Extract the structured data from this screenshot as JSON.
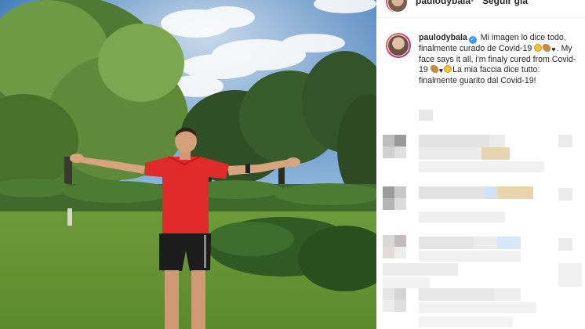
{
  "post": {
    "username": "paulodybala",
    "follow_label": "Seguir già",
    "header_dot": "•",
    "caption_emoji": [
      "grinning-face",
      "flexed-biceps",
      "heart",
      "flexed-biceps",
      "heart",
      "grinning-face"
    ]
  },
  "caption": {
    "username": "paulodybala",
    "part1": "Mi imagen lo dice todo, finalmente curado de Covid-19",
    "part2": "My face says it all, i'm finaly cured from Covid-19",
    "part3": "La mia faccia dice tutto: finalmente guarito dal Covid-19!"
  },
  "colors": {
    "accent": "#3897f0",
    "text": "#262626",
    "muted": "#8e8e8e",
    "divider": "#dbdbdb"
  },
  "comments": [
    {
      "state": "pixelated"
    },
    {
      "state": "pixelated"
    },
    {
      "state": "pixelated"
    },
    {
      "state": "pixelated"
    },
    {
      "state": "pixelated"
    }
  ]
}
